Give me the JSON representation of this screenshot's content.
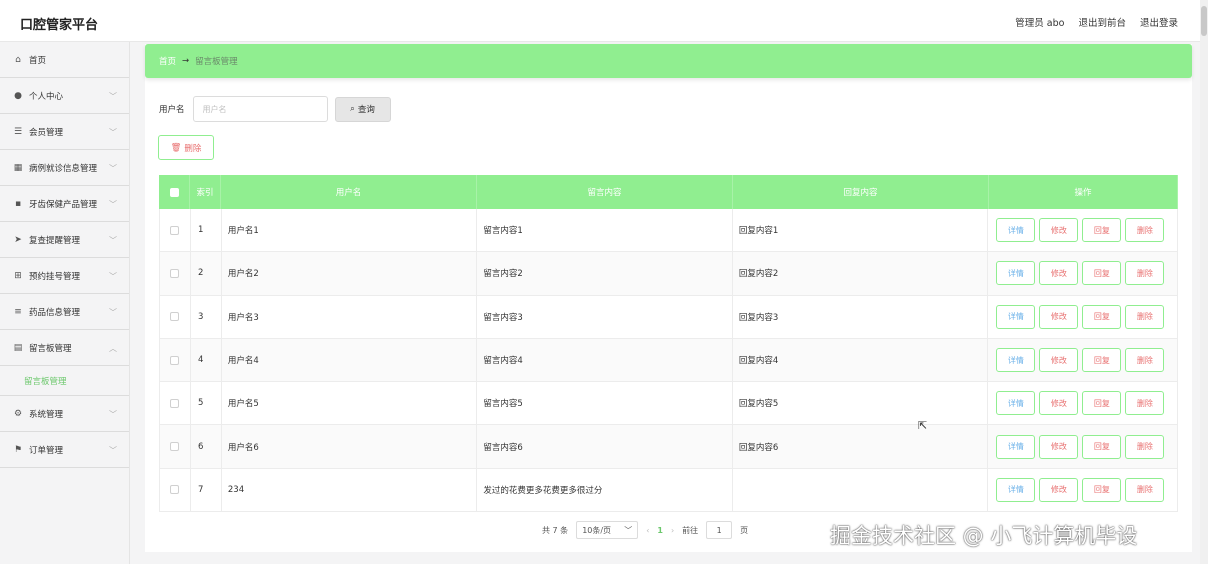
{
  "header": {
    "title": "口腔管家平台",
    "user_label": "管理员 abo",
    "front_link": "退出到前台",
    "logout_link": "退出登录"
  },
  "sidebar": {
    "items": [
      {
        "label": "首页",
        "icon": "home-icon"
      },
      {
        "label": "个人中心",
        "icon": "user-icon"
      },
      {
        "label": "会员管理",
        "icon": "sliders-icon"
      },
      {
        "label": "病例就诊信息管理",
        "icon": "grid-icon"
      },
      {
        "label": "牙齿保健产品管理",
        "icon": "apps-icon"
      },
      {
        "label": "复查提醒管理",
        "icon": "send-icon"
      },
      {
        "label": "预约挂号管理",
        "icon": "bank-icon"
      },
      {
        "label": "药品信息管理",
        "icon": "list-icon"
      },
      {
        "label": "留言板管理",
        "icon": "clipboard-icon"
      },
      {
        "label": "系统管理",
        "icon": "settings-icon"
      },
      {
        "label": "订单管理",
        "icon": "flag-icon"
      }
    ],
    "sub_active": "留言板管理"
  },
  "breadcrumb": {
    "home": "首页",
    "arrow": "→",
    "current": "留言板管理"
  },
  "search": {
    "label": "用户名",
    "placeholder": "用户名",
    "button": "查询"
  },
  "delete_button": "删除",
  "table": {
    "headers": {
      "index": "索引",
      "username": "用户名",
      "message": "留言内容",
      "reply": "回复内容",
      "operation": "操作"
    },
    "rows": [
      {
        "idx": "1",
        "username": "用户名1",
        "message": "留言内容1",
        "reply": "回复内容1"
      },
      {
        "idx": "2",
        "username": "用户名2",
        "message": "留言内容2",
        "reply": "回复内容2"
      },
      {
        "idx": "3",
        "username": "用户名3",
        "message": "留言内容3",
        "reply": "回复内容3"
      },
      {
        "idx": "4",
        "username": "用户名4",
        "message": "留言内容4",
        "reply": "回复内容4"
      },
      {
        "idx": "5",
        "username": "用户名5",
        "message": "留言内容5",
        "reply": "回复内容5"
      },
      {
        "idx": "6",
        "username": "用户名6",
        "message": "留言内容6",
        "reply": "回复内容6"
      },
      {
        "idx": "7",
        "username": "234",
        "message": "发过的花费更多花费更多很过分",
        "reply": ""
      }
    ],
    "row_actions": {
      "detail": "详情",
      "edit": "修改",
      "reply": "回复",
      "delete": "删除"
    }
  },
  "pagination": {
    "total": "共 7 条",
    "page_size": "10条/页",
    "current_page": "1",
    "goto_label": "前往",
    "goto_value": "1",
    "page_unit": "页"
  },
  "watermark": "掘金技术社区 @ 小飞计算机毕设",
  "colors": {
    "accent": "#90ee90",
    "danger_text": "#e87070",
    "info_text": "#6ab0e8"
  }
}
